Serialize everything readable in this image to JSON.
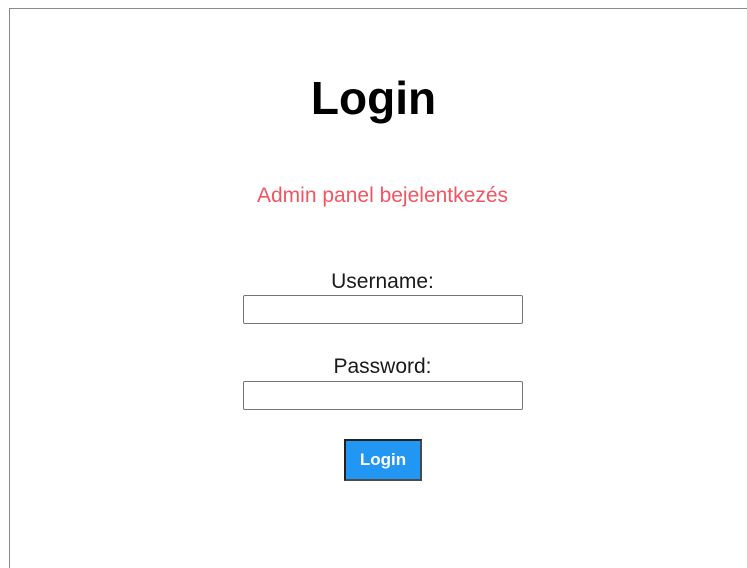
{
  "page": {
    "title": "Login",
    "subtitle": "Admin panel bejelentkezés"
  },
  "form": {
    "username_label": "Username:",
    "username_value": "",
    "password_label": "Password:",
    "password_value": "",
    "submit_label": "Login"
  },
  "colors": {
    "subtitle": "#f25562",
    "button_background": "#2196f3",
    "button_text": "#ffffff"
  }
}
